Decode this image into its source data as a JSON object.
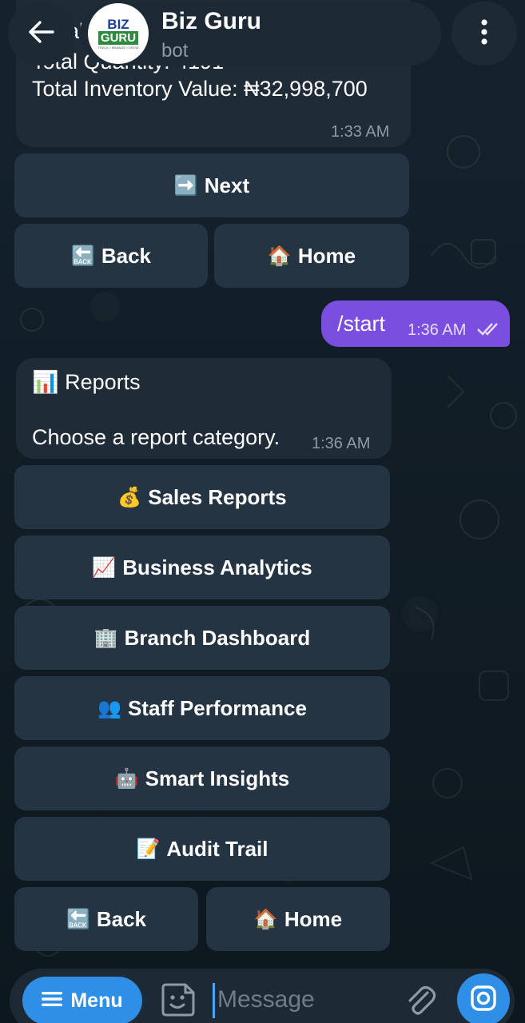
{
  "header": {
    "bot_name": "Biz Guru",
    "status": "bot",
    "avatar_line1": "BIZ",
    "avatar_line2": "GURU",
    "avatar_tagline": "TRACK • MANAGE • GROW"
  },
  "previous_message": {
    "partial_text": "al",
    "line1": "Total Quantity: 4191",
    "line2": "Total Inventory Value: ₦32,998,700",
    "time": "1:33 AM"
  },
  "previous_keyboard": {
    "next": {
      "emoji": "➡️",
      "label": "Next"
    },
    "back": {
      "emoji": "🔙",
      "label": "Back"
    },
    "home": {
      "emoji": "🏠",
      "label": "Home"
    }
  },
  "outgoing_message": {
    "text": "/start",
    "time": "1:36 AM"
  },
  "reports_message": {
    "emoji": "📊",
    "title": "Reports",
    "text": "Choose a report category.",
    "time": "1:36 AM"
  },
  "reports_keyboard": [
    {
      "emoji": "💰",
      "label": "Sales Reports"
    },
    {
      "emoji": "📈",
      "label": "Business Analytics"
    },
    {
      "emoji": "🏢",
      "label": "Branch Dashboard"
    },
    {
      "emoji": "👥",
      "label": "Staff Performance"
    },
    {
      "emoji": "🤖",
      "label": "Smart Insights"
    },
    {
      "emoji": "📝",
      "label": "Audit Trail"
    }
  ],
  "reports_nav": {
    "back": {
      "emoji": "🔙",
      "label": "Back"
    },
    "home": {
      "emoji": "🏠",
      "label": "Home"
    }
  },
  "input_bar": {
    "menu_label": "Menu",
    "placeholder": "Message"
  },
  "colors": {
    "background": "#0f1921",
    "bubble_incoming": "#1f2b36",
    "bubble_outgoing": "#7a4fe0",
    "keyboard_button": "#243442",
    "accent": "#2f8fe6"
  }
}
